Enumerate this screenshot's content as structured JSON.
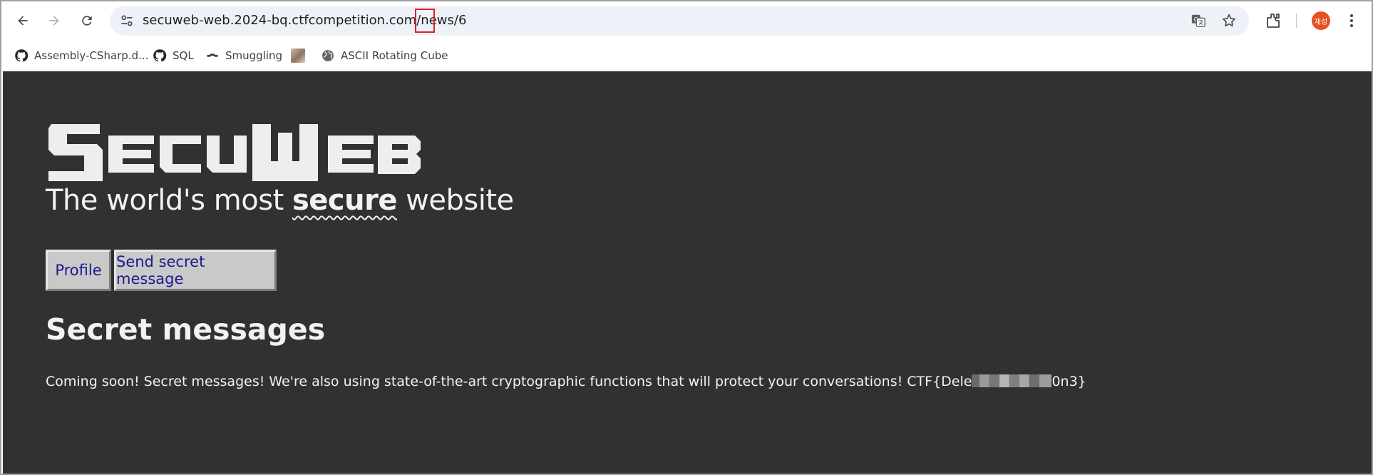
{
  "browser": {
    "url_host": "secuweb-web.2024-bq.ctfcompetition.com/news/",
    "url_path_highlight": "6",
    "profile_initials": "재성",
    "bookmarks": [
      {
        "label": "Assembly-CSharp.d...",
        "icon": "github-icon"
      },
      {
        "label": "SQL",
        "icon": "github-icon"
      },
      {
        "label": "Smuggling",
        "icon": "smuggling-icon"
      },
      {
        "label": "",
        "icon": "image-thumbnail"
      },
      {
        "label": "ASCII Rotating Cube",
        "icon": "globe-icon"
      }
    ]
  },
  "page": {
    "logo_text": "SECUWEB",
    "tagline_pre": "The world's most ",
    "tagline_emphasis": "secure",
    "tagline_post": " website",
    "buttons": {
      "profile": "Profile",
      "send_message": "Send secret message"
    },
    "section_title": "Secret messages",
    "body_pre": "Coming soon! Secret messages! We're also using state-of-the-art cryptographic functions that will protect your conversations! CTF{Dele",
    "body_post": "0n3}"
  },
  "colors": {
    "page_bg": "#313131",
    "text": "#f2f2f2",
    "button_bg": "#c9c9c9",
    "button_text": "#1a1a8c",
    "highlight_box": "#e0202a",
    "avatar": "#e8501e"
  }
}
